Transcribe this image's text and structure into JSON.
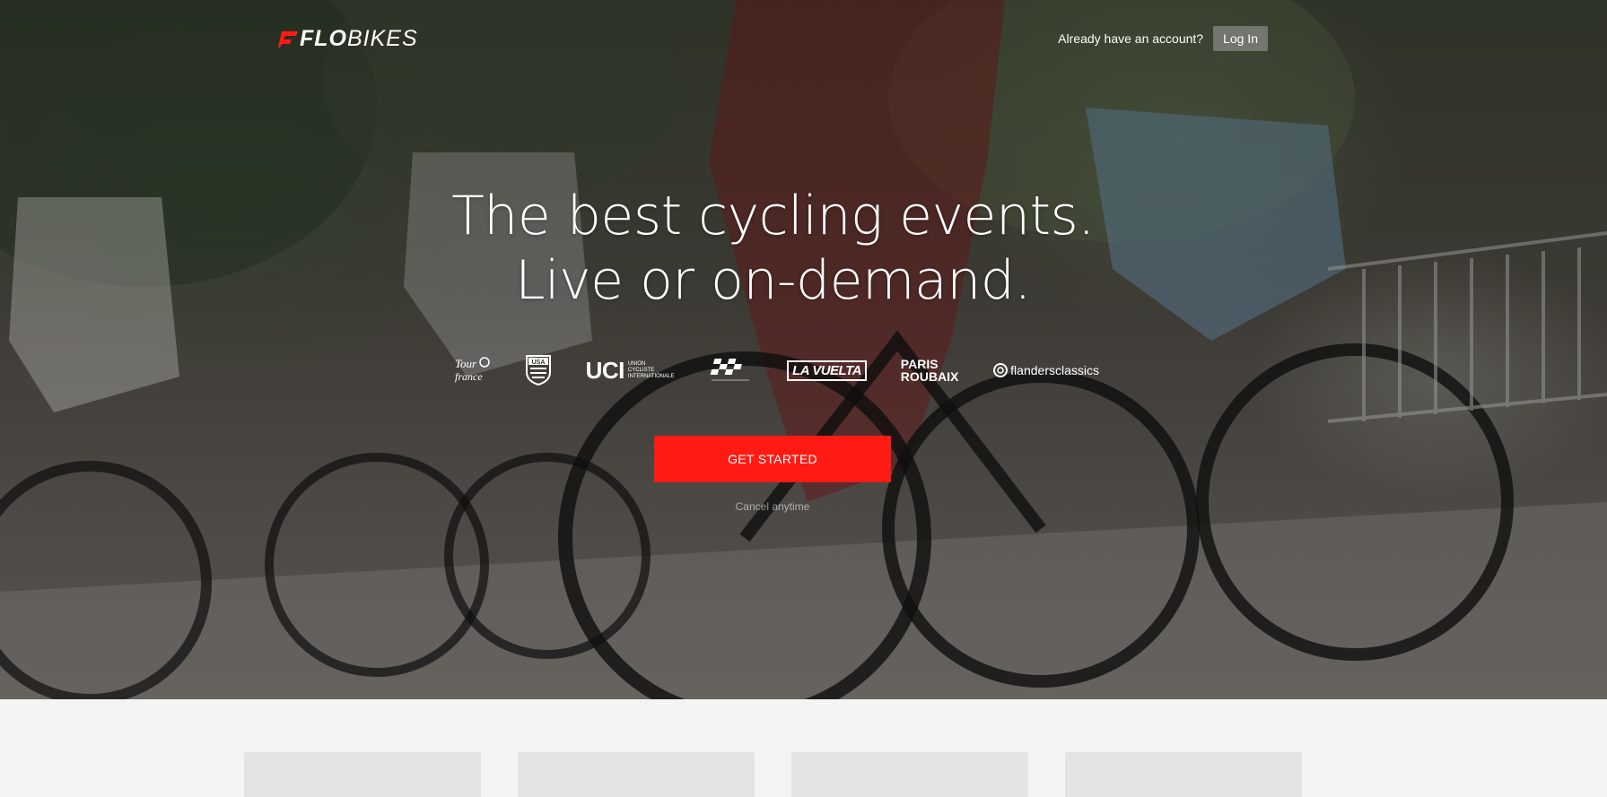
{
  "brand": {
    "logo_bold": "FLO",
    "logo_light": "BIKES"
  },
  "header": {
    "account_prompt": "Already have an account?",
    "login_label": "Log In"
  },
  "hero": {
    "headline_line1": "The best cycling events.",
    "headline_line2": "Live or on-demand."
  },
  "partners": [
    {
      "name": "Tour de France",
      "icon": "tour-de-france-logo"
    },
    {
      "name": "USA Cycling",
      "icon": "usa-cycling-logo",
      "text": "USA"
    },
    {
      "name": "UCI",
      "text": "UCI",
      "sub1": "UNION",
      "sub2": "CYCLISTE",
      "sub3": "INTERNATIONALE"
    },
    {
      "name": "Cyclocross",
      "icon": "checkered-flag-logo"
    },
    {
      "name": "La Vuelta",
      "text": "LA VUELTA"
    },
    {
      "name": "Paris Roubaix",
      "line1": "PARIS",
      "line2": "ROUBAIX"
    },
    {
      "name": "Flanders Classics",
      "text": "flandersclassics"
    }
  ],
  "cta": {
    "label": "GET STARTED",
    "note": "Cancel anytime"
  },
  "colors": {
    "accent": "#ff1b14",
    "page_bg": "#f4f4f5",
    "card_bg": "#e3e3e4"
  },
  "cards_count": 4
}
